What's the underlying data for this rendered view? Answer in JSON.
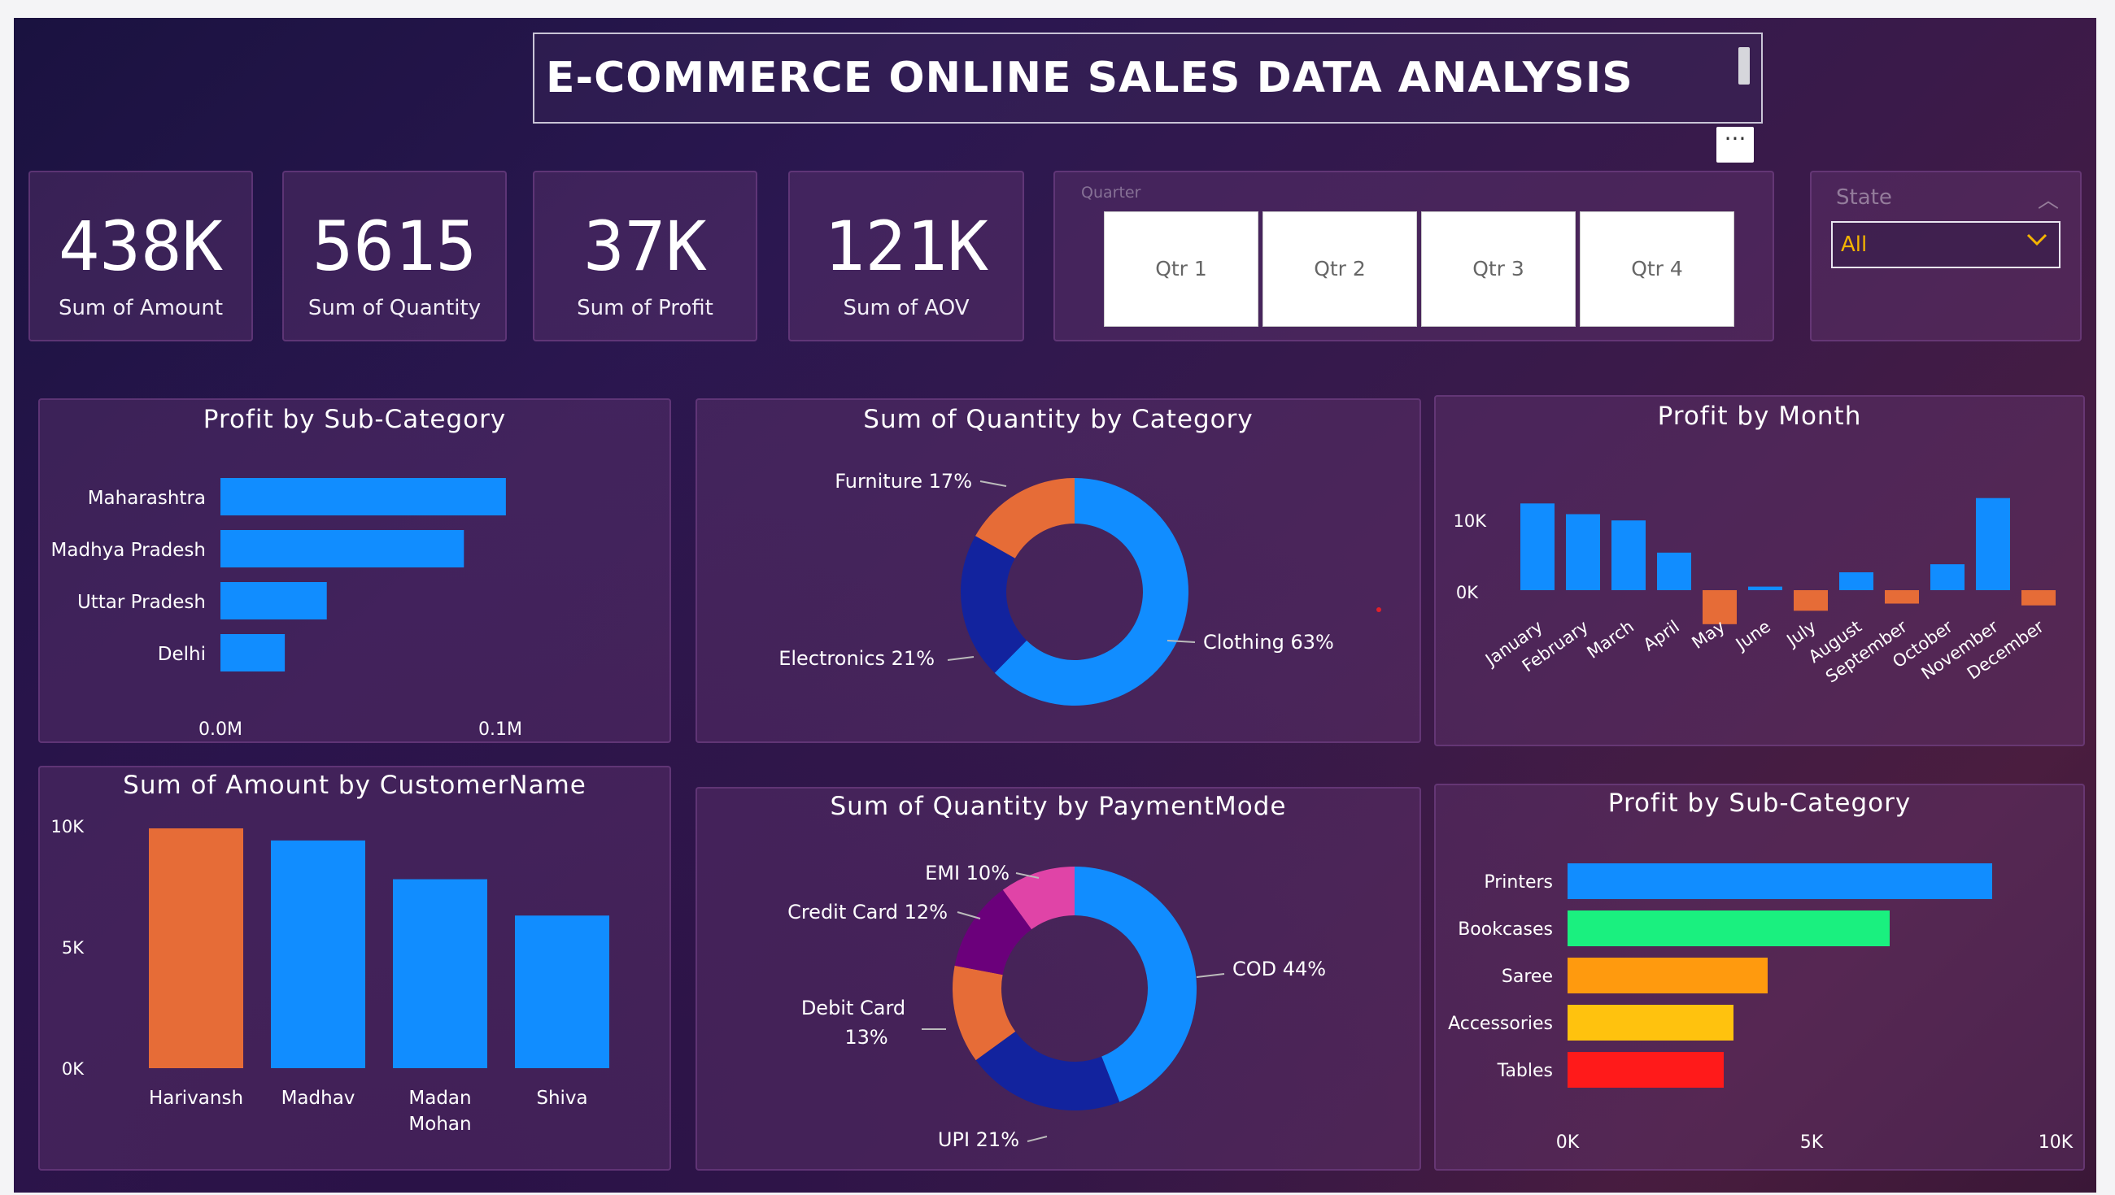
{
  "header": {
    "title": "E-COMMERCE ONLINE SALES DATA ANALYSIS",
    "more_label": "···"
  },
  "kpis": [
    {
      "value": "438K",
      "label": "Sum of Amount"
    },
    {
      "value": "5615",
      "label": "Sum of Quantity"
    },
    {
      "value": "37K",
      "label": "Sum of Profit"
    },
    {
      "value": "121K",
      "label": "Sum of AOV"
    }
  ],
  "quarter_slicer": {
    "title": "Quarter",
    "options": [
      "Qtr 1",
      "Qtr 2",
      "Qtr 3",
      "Qtr 4"
    ]
  },
  "state_slicer": {
    "title": "State",
    "selected": "All"
  },
  "colors": {
    "blue": "#118DFF",
    "orange": "#E66C37",
    "navy": "#12239E",
    "purple": "#6B007B",
    "pink": "#E044A7",
    "green": "#1AF07F",
    "amber": "#FF9A0E",
    "yellow": "#FFC20E",
    "red": "#FF1A1A"
  },
  "chart_data": [
    {
      "id": "profit_by_state",
      "type": "bar",
      "title": "Profit by Sub-Category",
      "categories": [
        "Maharashtra",
        "Madhya Pradesh",
        "Uttar Pradesh",
        "Delhi"
      ],
      "values": [
        0.102,
        0.087,
        0.038,
        0.023
      ],
      "xticks": [
        "0.0M",
        "0.1M"
      ],
      "xlim": [
        0,
        0.1
      ]
    },
    {
      "id": "qty_by_category",
      "type": "pie",
      "title": "Sum of Quantity by Category",
      "labels": [
        "Clothing 63%",
        "Electronics 21%",
        "Furniture 17%"
      ],
      "values": [
        63,
        21,
        17
      ]
    },
    {
      "id": "profit_by_month",
      "type": "bar",
      "title": "Profit by Month",
      "categories": [
        "January",
        "February",
        "March",
        "April",
        "May",
        "June",
        "July",
        "August",
        "September",
        "October",
        "November",
        "December"
      ],
      "values": [
        9700,
        8500,
        7800,
        4200,
        -3800,
        400,
        -2300,
        2000,
        -1500,
        2900,
        10300,
        -1700
      ],
      "yticks": [
        "10K",
        "0K"
      ],
      "ylim": [
        -5000,
        11000
      ]
    },
    {
      "id": "amount_by_customer",
      "type": "bar",
      "title": "Sum of Amount by CustomerName",
      "categories": [
        "Harivansh",
        "Madhav",
        "Madan Mohan",
        "Shiva"
      ],
      "values": [
        9900,
        9400,
        7800,
        6300
      ],
      "yticks": [
        "10K",
        "5K",
        "0K"
      ],
      "ylim": [
        0,
        10000
      ]
    },
    {
      "id": "qty_by_payment",
      "type": "pie",
      "title": "Sum of Quantity by PaymentMode",
      "labels": [
        "COD 44%",
        "UPI 21%",
        "Debit Card 13%",
        "Credit Card 12%",
        "EMI 10%"
      ],
      "values": [
        44,
        21,
        13,
        12,
        10
      ]
    },
    {
      "id": "profit_by_subcategory",
      "type": "bar",
      "title": "Profit by Sub-Category",
      "categories": [
        "Printers",
        "Bookcases",
        "Saree",
        "Accessories",
        "Tables"
      ],
      "values": [
        8700,
        6600,
        4100,
        3400,
        3200
      ],
      "xticks": [
        "0K",
        "5K",
        "10K"
      ],
      "xlim": [
        0,
        10000
      ]
    }
  ]
}
